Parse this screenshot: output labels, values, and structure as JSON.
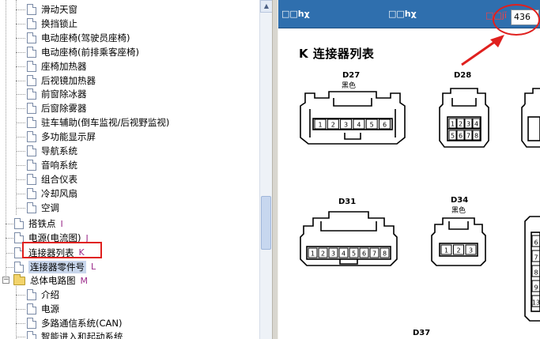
{
  "tree": {
    "subitems": [
      {
        "label": "滑动天窗"
      },
      {
        "label": "换挡锁止"
      },
      {
        "label": "电动座椅(驾驶员座椅)"
      },
      {
        "label": "电动座椅(前排乘客座椅)"
      },
      {
        "label": "座椅加热器"
      },
      {
        "label": "后视镜加热器"
      },
      {
        "label": "前窗除冰器"
      },
      {
        "label": "后窗除雾器"
      },
      {
        "label": "驻车辅助(倒车监视/后视野监视)"
      },
      {
        "label": "多功能显示屏"
      },
      {
        "label": "导航系统"
      },
      {
        "label": "音响系统"
      },
      {
        "label": "组合仪表"
      },
      {
        "label": "冷却风扇"
      },
      {
        "label": "空调"
      }
    ],
    "top_items": [
      {
        "label": "搭铁点",
        "letter": "I"
      },
      {
        "label": "电源(电流图)",
        "letter": "J"
      },
      {
        "label": "连接器列表",
        "letter": "K"
      },
      {
        "label": "连接器零件号",
        "letter": "L"
      }
    ],
    "folder": {
      "label": "总体电路图",
      "letter": "M",
      "expander": "−"
    },
    "folder_items": [
      {
        "label": "介绍"
      },
      {
        "label": "电源"
      },
      {
        "label": "多路通信系统(CAN)"
      },
      {
        "label": "智能进入和起动系统"
      }
    ]
  },
  "toolbar": {
    "text_left": "□□hχ",
    "text_mid": "□□hχ",
    "page_label": "□□jĭ",
    "page_value": "436"
  },
  "page": {
    "heading": "K  连接器列表",
    "connectors": [
      {
        "id": "D27",
        "sub": "黑色",
        "pins": [
          "1",
          "2",
          "3",
          "4",
          "5",
          "6"
        ]
      },
      {
        "id": "D28",
        "sub": "",
        "pins": [
          "1",
          "2",
          "3",
          "4",
          "5",
          "6",
          "7",
          "8"
        ]
      },
      {
        "id": "D31",
        "sub": "",
        "pins": [
          "1",
          "2",
          "3",
          "4",
          "5",
          "6",
          "7",
          "8"
        ]
      },
      {
        "id": "D34",
        "sub": "黑色",
        "pins": [
          "1",
          "2",
          "3"
        ]
      },
      {
        "id": "D37",
        "sub": "",
        "pins": []
      }
    ],
    "partial_pins": [
      "6",
      "7",
      "8",
      "9",
      "13"
    ]
  },
  "colors": {
    "toolbar": "#2f6fae",
    "annotation_red": "#e0201e",
    "selected": "#c8d6ec",
    "letter": "#9b2b8a"
  }
}
